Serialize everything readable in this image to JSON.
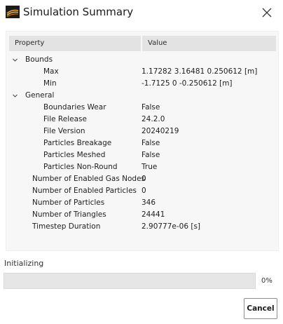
{
  "window": {
    "title": "Simulation Summary",
    "icon": "app-logo-icon",
    "close_icon": "close-icon"
  },
  "table": {
    "headers": {
      "property": "Property",
      "value": "Value"
    },
    "rows": [
      {
        "name": "Bounds",
        "value": "",
        "level": 0,
        "expandable": true
      },
      {
        "name": "Max",
        "value": "1.17282 3.16481 0.250612 [m]",
        "level": 2
      },
      {
        "name": "Min",
        "value": "-1.7125 0 -0.250612 [m]",
        "level": 2
      },
      {
        "name": "General",
        "value": "",
        "level": 0,
        "expandable": true
      },
      {
        "name": "Boundaries Wear",
        "value": "False",
        "level": 2
      },
      {
        "name": "File Release",
        "value": "24.2.0",
        "level": 2
      },
      {
        "name": "File Version",
        "value": "20240219",
        "level": 2
      },
      {
        "name": "Particles Breakage",
        "value": "False",
        "level": 2
      },
      {
        "name": "Particles Meshed",
        "value": "False",
        "level": 2
      },
      {
        "name": "Particles Non-Round",
        "value": "True",
        "level": 2
      },
      {
        "name": "Number of Enabled Gas Nodes",
        "value": "0",
        "level": 1
      },
      {
        "name": "Number of Enabled Particles",
        "value": "0",
        "level": 1
      },
      {
        "name": "Number of Particles",
        "value": "346",
        "level": 1
      },
      {
        "name": "Number of Triangles",
        "value": "24441",
        "level": 1
      },
      {
        "name": "Timestep Duration",
        "value": "2.90777e-06 [s]",
        "level": 1
      }
    ]
  },
  "status": {
    "label": "Initializing",
    "progress_percent": 0,
    "progress_text": "0%"
  },
  "buttons": {
    "cancel": "Cancel"
  }
}
